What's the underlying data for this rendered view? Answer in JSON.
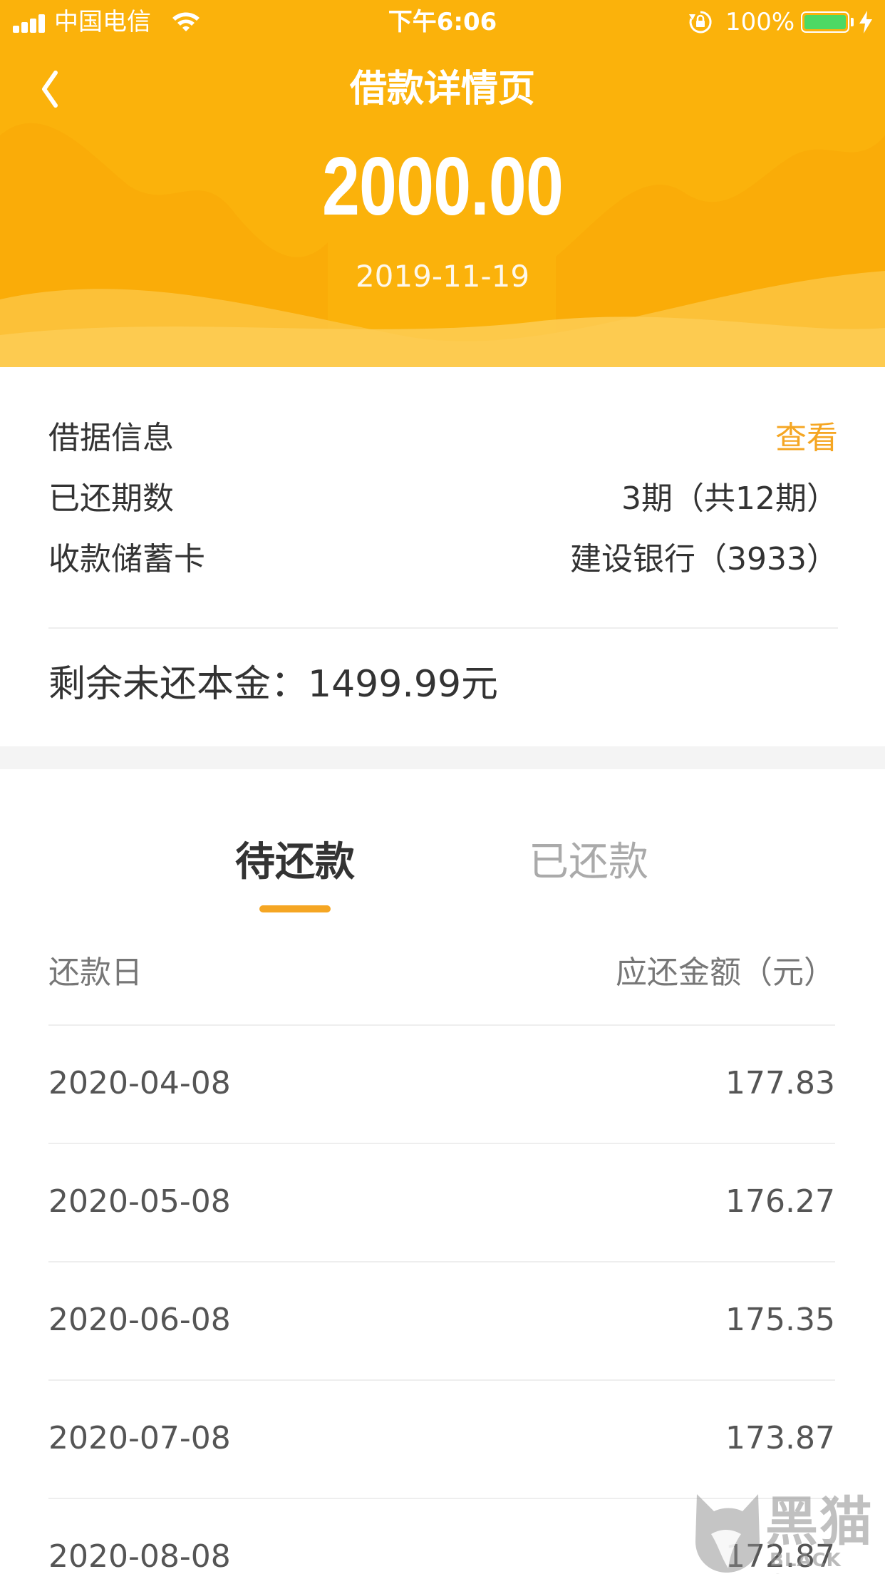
{
  "status_bar": {
    "carrier": "中国电信",
    "time": "下午6:06",
    "battery_percent": "100%",
    "battery_level": 1.0,
    "icons": [
      "signal-icon",
      "wifi-icon",
      "rotation-lock-icon",
      "battery-icon",
      "charging-icon"
    ]
  },
  "nav": {
    "title": "借款详情页",
    "back_icon": "chevron-left-icon"
  },
  "loan": {
    "amount": "2000.00",
    "date": "2019-11-19"
  },
  "info": {
    "rows": [
      {
        "label": "借据信息",
        "value": "查看"
      },
      {
        "label": "已还期数",
        "value": "3期（共12期）"
      },
      {
        "label": "收款储蓄卡",
        "value": "建设银行（3933）"
      }
    ],
    "remaining": "剩余未还本金：1499.99元"
  },
  "tabs": {
    "items": [
      {
        "label": "待还款"
      },
      {
        "label": "已还款"
      }
    ],
    "active": 0
  },
  "schedule": {
    "headers": {
      "date": "还款日",
      "amount": "应还金额（元）"
    },
    "rows": [
      {
        "date": "2020-04-08",
        "amount": "177.83"
      },
      {
        "date": "2020-05-08",
        "amount": "176.27"
      },
      {
        "date": "2020-06-08",
        "amount": "175.35"
      },
      {
        "date": "2020-07-08",
        "amount": "173.87"
      },
      {
        "date": "2020-08-08",
        "amount": "172.87"
      }
    ]
  },
  "watermark": {
    "text": "黑猫",
    "subtext": "BLACK CAT"
  },
  "colors": {
    "header_bg": "#fbb20b",
    "accent": "#f5a623",
    "text_primary": "#333333",
    "text_muted": "#aaaaaa"
  }
}
